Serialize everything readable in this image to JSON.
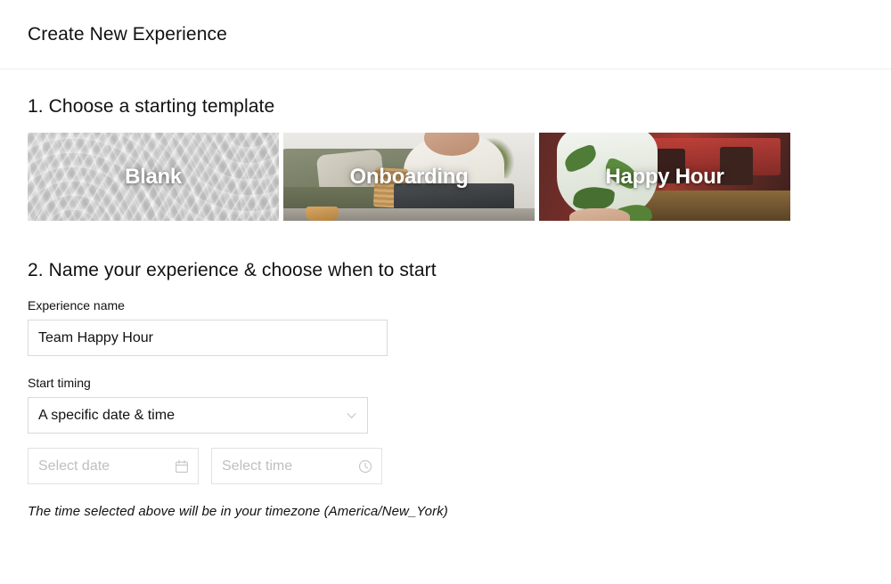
{
  "header": {
    "title": "Create New Experience"
  },
  "sections": {
    "step1_heading": "1. Choose a starting template",
    "step2_heading": "2. Name your experience & choose when to start"
  },
  "templates": [
    {
      "label": "Blank",
      "art": "texture-plaster"
    },
    {
      "label": "Onboarding",
      "art": "photo-person-laptop-sofa"
    },
    {
      "label": "Happy Hour",
      "art": "photo-mojito-bar"
    }
  ],
  "form": {
    "name_label": "Experience name",
    "name_value": "Team Happy Hour",
    "name_placeholder": "Experience name",
    "timing_label": "Start timing",
    "timing_value": "A specific date & time",
    "timing_icon": "chevron-down-icon",
    "date_placeholder": "Select date",
    "date_value": "",
    "date_icon": "calendar-icon",
    "time_placeholder": "Select time",
    "time_value": "",
    "time_icon": "clock-icon",
    "timezone_note": "The time selected above will be in your timezone (America/New_York)"
  },
  "colors": {
    "page_bg": "#ffffff",
    "text": "#111111",
    "border": "#d9d9d9",
    "divider": "#eceef0",
    "placeholder": "#bfbfbf",
    "icon_muted": "#c9c9c9"
  }
}
